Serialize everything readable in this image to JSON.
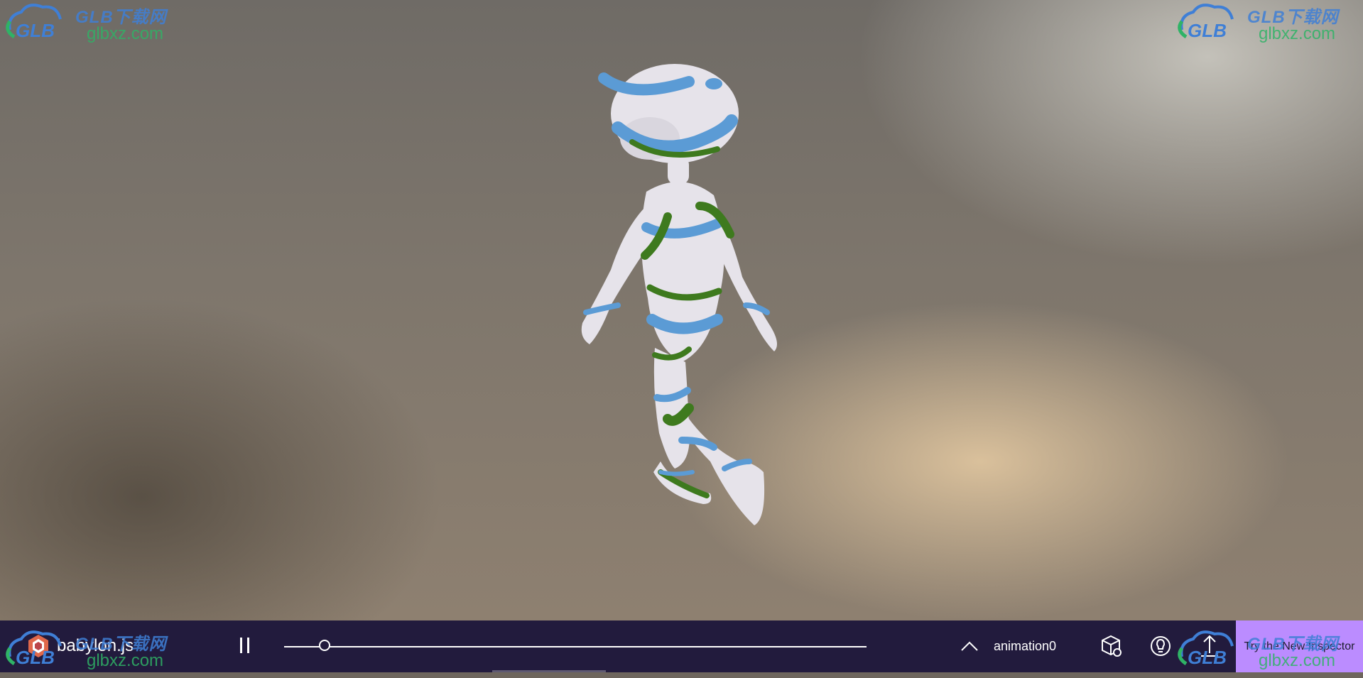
{
  "watermark": {
    "title": "GLB下载网",
    "site": "glbxz.com",
    "logo_text": "GLB"
  },
  "toolbar": {
    "brand_label": "babylon.js",
    "animation_name": "animation0",
    "progress": 0.07,
    "inspector_label": "Try the New Inspector"
  },
  "icons": {
    "brand": "babylon-logo-icon",
    "pause": "pause-icon",
    "chevron": "chevron-up-icon",
    "settings": "cube-settings-icon",
    "light": "lightbulb-icon",
    "upload": "upload-arrow-icon"
  },
  "colors": {
    "toolbar_bg": "#221b3d",
    "inspector_bg": "#bb8cff",
    "model_blue": "#5b9bd5",
    "model_green": "#3e7a1e",
    "watermark_blue": "#3f7fd6",
    "watermark_green": "#2fb366"
  }
}
